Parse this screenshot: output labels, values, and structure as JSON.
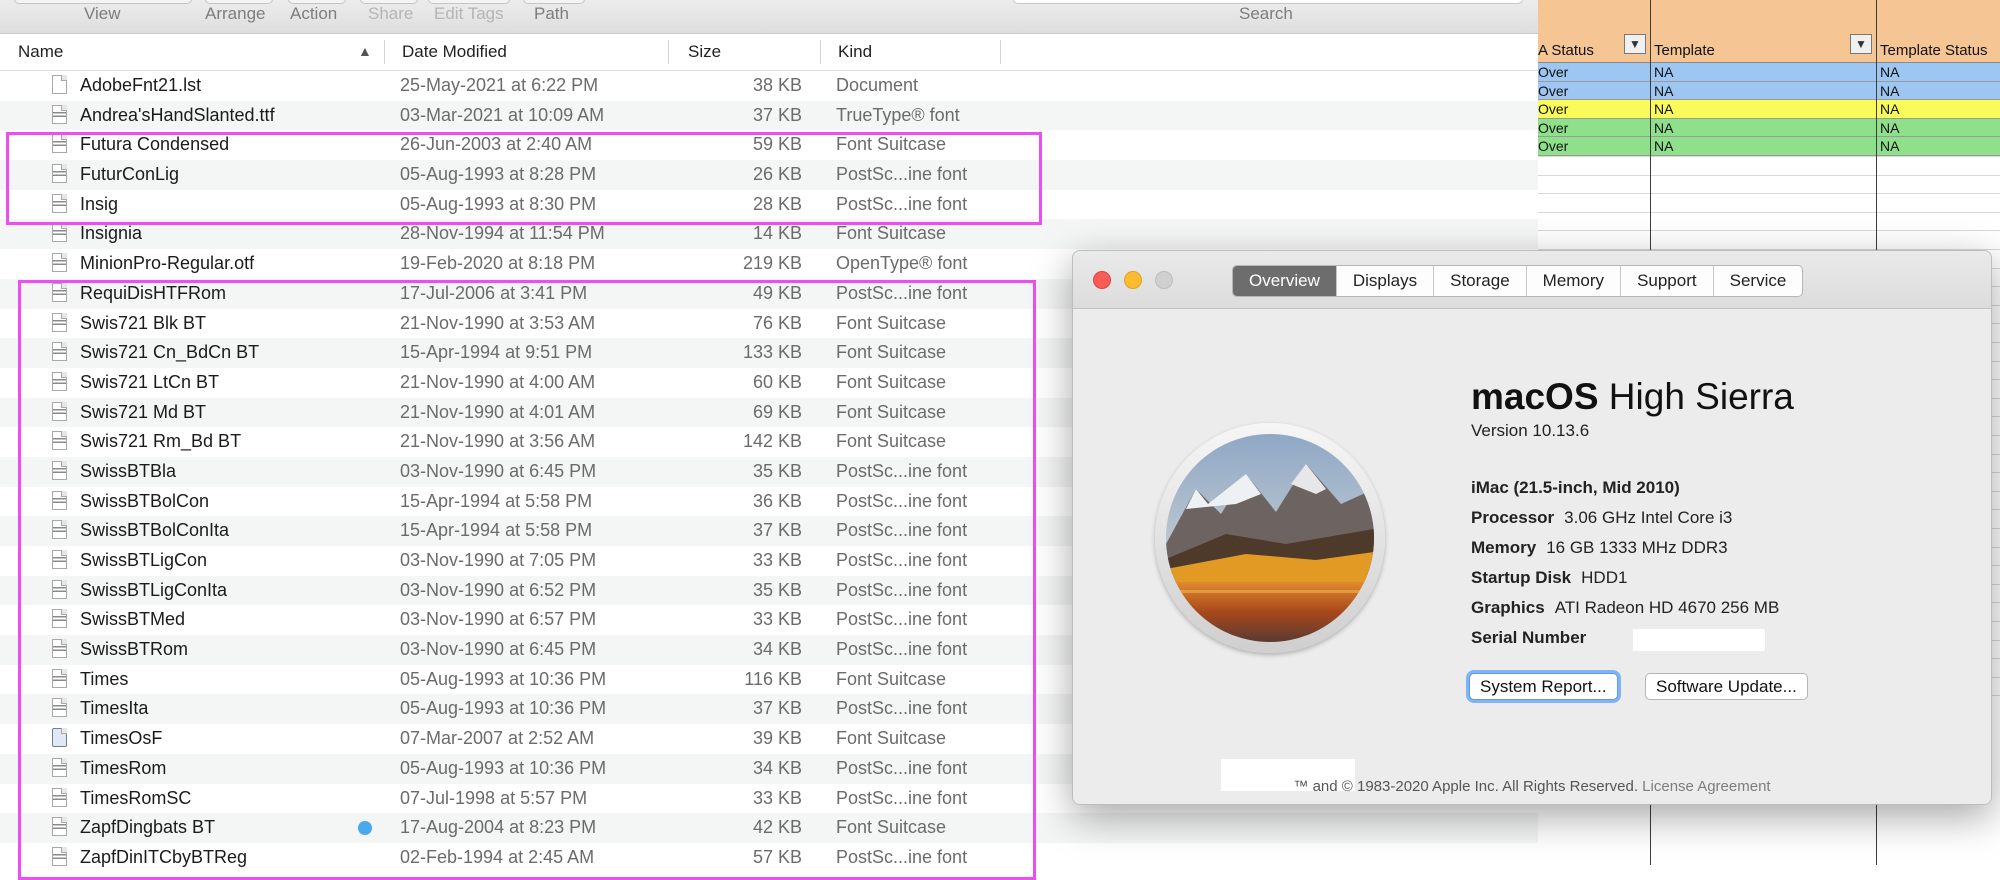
{
  "toolbar": {
    "view": "View",
    "arrange": "Arrange",
    "action": "Action",
    "share": "Share",
    "edit_tags": "Edit Tags",
    "path": "Path",
    "search": "Search"
  },
  "columns": {
    "name": "Name",
    "date": "Date Modified",
    "size": "Size",
    "kind": "Kind"
  },
  "files": [
    {
      "name": "AdobeFnt21.lst",
      "date": "25-May-2021 at 6:22 PM",
      "size": "38 KB",
      "kind": "Document",
      "icon": "document"
    },
    {
      "name": "Andrea'sHandSlanted.ttf",
      "date": "03-Mar-2021 at 10:09 AM",
      "size": "37 KB",
      "kind": "TrueType® font",
      "icon": "font"
    },
    {
      "name": "Futura Condensed",
      "date": "26-Jun-2003 at 2:40 AM",
      "size": "59 KB",
      "kind": "Font Suitcase",
      "icon": "font"
    },
    {
      "name": "FuturConLig",
      "date": "05-Aug-1993 at 8:28 PM",
      "size": "26 KB",
      "kind": "PostSc...ine font",
      "icon": "font"
    },
    {
      "name": "Insig",
      "date": "05-Aug-1993 at 8:30 PM",
      "size": "28 KB",
      "kind": "PostSc...ine font",
      "icon": "font"
    },
    {
      "name": "Insignia",
      "date": "28-Nov-1994 at 11:54 PM",
      "size": "14 KB",
      "kind": "Font Suitcase",
      "icon": "font"
    },
    {
      "name": "MinionPro-Regular.otf",
      "date": "19-Feb-2020 at 8:18 PM",
      "size": "219 KB",
      "kind": "OpenType® font",
      "icon": "font"
    },
    {
      "name": "RequiDisHTFRom",
      "date": "17-Jul-2006 at 3:41 PM",
      "size": "49 KB",
      "kind": "PostSc...ine font",
      "icon": "font"
    },
    {
      "name": "Swis721 Blk BT",
      "date": "21-Nov-1990 at 3:53 AM",
      "size": "76 KB",
      "kind": "Font Suitcase",
      "icon": "font"
    },
    {
      "name": "Swis721 Cn_BdCn BT",
      "date": "15-Apr-1994 at 9:51 PM",
      "size": "133 KB",
      "kind": "Font Suitcase",
      "icon": "font"
    },
    {
      "name": "Swis721 LtCn BT",
      "date": "21-Nov-1990 at 4:00 AM",
      "size": "60 KB",
      "kind": "Font Suitcase",
      "icon": "font"
    },
    {
      "name": "Swis721 Md BT",
      "date": "21-Nov-1990 at 4:01 AM",
      "size": "69 KB",
      "kind": "Font Suitcase",
      "icon": "font"
    },
    {
      "name": "Swis721 Rm_Bd BT",
      "date": "21-Nov-1990 at 3:56 AM",
      "size": "142 KB",
      "kind": "Font Suitcase",
      "icon": "font"
    },
    {
      "name": "SwissBTBla",
      "date": "03-Nov-1990 at 6:45 PM",
      "size": "35 KB",
      "kind": "PostSc...ine font",
      "icon": "font"
    },
    {
      "name": "SwissBTBolCon",
      "date": "15-Apr-1994 at 5:58 PM",
      "size": "36 KB",
      "kind": "PostSc...ine font",
      "icon": "font"
    },
    {
      "name": "SwissBTBolConIta",
      "date": "15-Apr-1994 at 5:58 PM",
      "size": "37 KB",
      "kind": "PostSc...ine font",
      "icon": "font"
    },
    {
      "name": "SwissBTLigCon",
      "date": "03-Nov-1990 at 7:05 PM",
      "size": "33 KB",
      "kind": "PostSc...ine font",
      "icon": "font"
    },
    {
      "name": "SwissBTLigConIta",
      "date": "03-Nov-1990 at 6:52 PM",
      "size": "35 KB",
      "kind": "PostSc...ine font",
      "icon": "font"
    },
    {
      "name": "SwissBTMed",
      "date": "03-Nov-1990 at 6:57 PM",
      "size": "33 KB",
      "kind": "PostSc...ine font",
      "icon": "font"
    },
    {
      "name": "SwissBTRom",
      "date": "03-Nov-1990 at 6:45 PM",
      "size": "34 KB",
      "kind": "PostSc...ine font",
      "icon": "font"
    },
    {
      "name": "Times",
      "date": "05-Aug-1993 at 10:36 PM",
      "size": "116 KB",
      "kind": "Font Suitcase",
      "icon": "font"
    },
    {
      "name": "TimesIta",
      "date": "05-Aug-1993 at 10:36 PM",
      "size": "37 KB",
      "kind": "PostSc...ine font",
      "icon": "font"
    },
    {
      "name": "TimesOsF",
      "date": "07-Mar-2007 at 2:52 AM",
      "size": "39 KB",
      "kind": "Font Suitcase",
      "icon": "suitcase"
    },
    {
      "name": "TimesRom",
      "date": "05-Aug-1993 at 10:36 PM",
      "size": "34 KB",
      "kind": "PostSc...ine font",
      "icon": "font"
    },
    {
      "name": "TimesRomSC",
      "date": "07-Jul-1998 at 5:57 PM",
      "size": "33 KB",
      "kind": "PostSc...ine font",
      "icon": "font"
    },
    {
      "name": "ZapfDingbats BT",
      "date": "17-Aug-2004 at 8:23 PM",
      "size": "42 KB",
      "kind": "Font Suitcase",
      "icon": "font",
      "tag": "blue"
    },
    {
      "name": "ZapfDinITCbyBTReg",
      "date": "02-Feb-1994 at 2:45 AM",
      "size": "57 KB",
      "kind": "PostSc...ine font",
      "icon": "font"
    }
  ],
  "sheet": {
    "headers": [
      "A Status",
      "Template",
      "Template  Status"
    ],
    "rows": [
      {
        "status": "Over",
        "template": "NA",
        "tstatus": "NA",
        "color": "#9ec6f3"
      },
      {
        "status": "Over",
        "template": "NA",
        "tstatus": "NA",
        "color": "#9ec6f3"
      },
      {
        "status": "Over",
        "template": "NA",
        "tstatus": "NA",
        "color": "#fafa5a"
      },
      {
        "status": "Over",
        "template": "NA",
        "tstatus": "NA",
        "color": "#8ee08b"
      },
      {
        "status": "Over",
        "template": "NA",
        "tstatus": "NA",
        "color": "#8ee08b"
      }
    ]
  },
  "about": {
    "tabs": [
      "Overview",
      "Displays",
      "Storage",
      "Memory",
      "Support",
      "Service"
    ],
    "active_tab": "Overview",
    "os_bold": "macOS",
    "os_rest": "High Sierra",
    "version": "Version 10.13.6",
    "model": "iMac (21.5-inch, Mid 2010)",
    "specs": [
      {
        "label": "Processor",
        "value": "3.06 GHz Intel Core i3"
      },
      {
        "label": "Memory",
        "value": "16 GB 1333 MHz DDR3"
      },
      {
        "label": "Startup Disk",
        "value": "HDD1"
      },
      {
        "label": "Graphics",
        "value": "ATI Radeon HD 4670 256 MB"
      },
      {
        "label": "Serial Number",
        "value": ""
      }
    ],
    "system_report": "System Report...",
    "software_update": "Software Update...",
    "footer": "™ and © 1983-2020 Apple Inc. All Rights Reserved.",
    "license": "License Agreement"
  },
  "colors": {
    "highlight": "#ee4ef1",
    "sheet_header": "#f6c594",
    "active_tab": "#6d6d6d",
    "tag_blue": "#4aa8f0"
  }
}
